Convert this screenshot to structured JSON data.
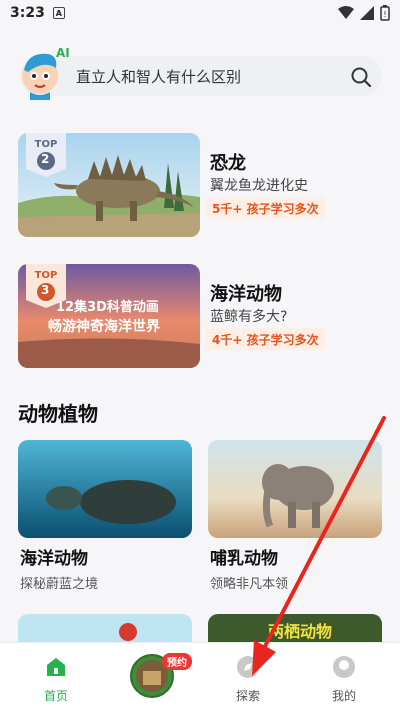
{
  "status_bar": {
    "time": "3:23",
    "notif_letter": "A"
  },
  "search": {
    "placeholder": "直立人和智人有什么区别",
    "ai_badge": "AI"
  },
  "featured": [
    {
      "rank": "2",
      "top_label": "TOP",
      "title": "恐龙",
      "subtitle": "翼龙鱼龙进化史",
      "tag": "5千+ 孩子学习多次"
    },
    {
      "rank": "3",
      "top_label": "TOP",
      "title": "海洋动物",
      "subtitle": "蓝鲸有多大?",
      "tag": "4千+ 孩子学习多次",
      "thumb_caption_line1": "12集3D科普动画",
      "thumb_caption_line2": "畅游神奇海洋世界"
    }
  ],
  "section": {
    "title": "动物植物"
  },
  "grid": [
    {
      "title": "海洋动物",
      "subtitle": "探秘蔚蓝之境"
    },
    {
      "title": "哺乳动物",
      "subtitle": "领略非凡本领"
    }
  ],
  "grid_bottom": {
    "right_caption": "两栖动物"
  },
  "nav": {
    "home": "首页",
    "explore": "探索",
    "mine": "我的",
    "center_badge": "预约"
  },
  "colors": {
    "accent_green": "#27b34b",
    "tag_orange": "#e8551c",
    "badge_red": "#e53935"
  }
}
